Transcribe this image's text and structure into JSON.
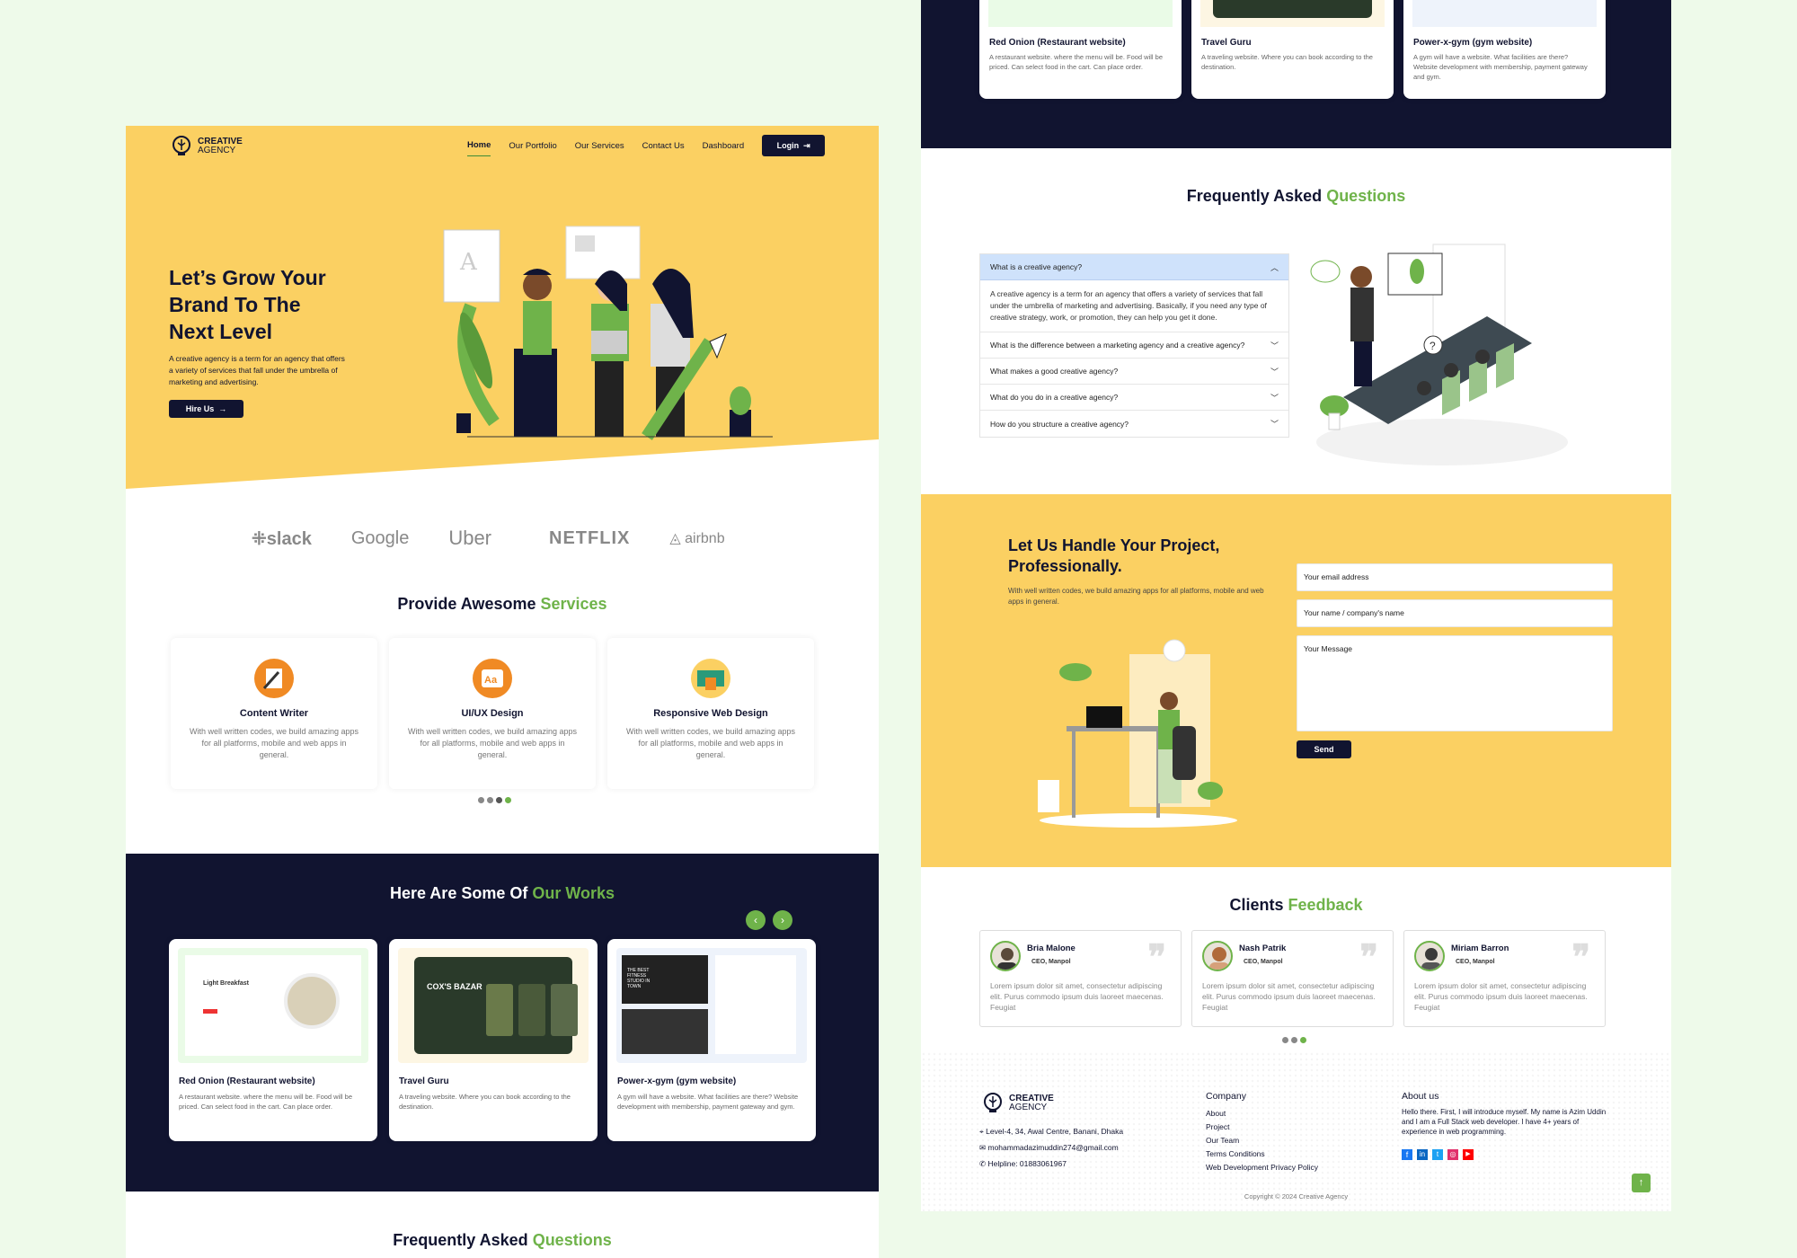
{
  "brand": {
    "name_line1": "CREATIVE",
    "name_line2": "AGENCY"
  },
  "nav": {
    "items": [
      "Home",
      "Our Portfolio",
      "Our Services",
      "Contact Us",
      "Dashboard"
    ],
    "login": "Login"
  },
  "hero": {
    "title_lines": [
      "Let’s Grow Your",
      "Brand To The",
      "Next Level"
    ],
    "text": "A creative agency is a term for an agency that offers a variety of services that fall under the umbrella of marketing and advertising.",
    "button": "Hire Us"
  },
  "partners": [
    "slack",
    "Google",
    "Uber",
    "NETFLIX",
    "airbnb"
  ],
  "services": {
    "title": "Provide Awesome",
    "title_accent": "Services",
    "items": [
      {
        "title": "Content Writer",
        "desc": "With well written codes, we build amazing apps for all platforms, mobile and web apps in general."
      },
      {
        "title": "UI/UX Design",
        "desc": "With well written codes, we build amazing apps for all platforms, mobile and web apps in general."
      },
      {
        "title": "Responsive Web Design",
        "desc": "With well written codes, we build amazing apps for all platforms, mobile and web apps in general."
      }
    ]
  },
  "works": {
    "title": "Here Are Some Of",
    "title_accent": "Our Works",
    "items": [
      {
        "title": "Red Onion (Restaurant website)",
        "desc": "A restaurant website. where the menu will be. Food will be priced. Can select food in the cart. Can place order.",
        "shot_label": "Light Breakfast"
      },
      {
        "title": "Travel Guru",
        "desc": "A traveling website. Where you can book according to the destination.",
        "shot_label": "COX'S BAZAR"
      },
      {
        "title": "Power-x-gym (gym website)",
        "desc": "A gym will have a website. What facilities are there? Website development with membership, payment gateway and gym.",
        "shot_label": "THE BEST FITNESS STUDIO IN TOWN"
      }
    ]
  },
  "faq": {
    "title": "Frequently Asked",
    "title_accent": "Questions",
    "items": [
      {
        "q": "What is a creative agency?",
        "a": "A creative agency is a term for an agency that offers a variety of services that fall under the umbrella of marketing and advertising. Basically, if you need any type of creative strategy, work, or promotion, they can help you get it done."
      },
      {
        "q": "What is the difference between a marketing agency and a creative agency?"
      },
      {
        "q": "What makes a good creative agency?"
      },
      {
        "q": "What do you do in a creative agency?"
      },
      {
        "q": "How do you structure a creative agency?"
      }
    ]
  },
  "contact": {
    "title_lines": [
      "Let Us Handle Your Project,",
      "Professionally."
    ],
    "text": "With well written codes, we build amazing apps for all platforms, mobile and web apps in general.",
    "email_placeholder": "Your email address",
    "name_placeholder": "Your name / company's name",
    "message_placeholder": "Your Message",
    "send": "Send"
  },
  "feedback": {
    "title": "Clients",
    "title_accent": "Feedback",
    "items": [
      {
        "name": "Bria Malone",
        "role": "CEO, Manpol",
        "text": "Lorem ipsum dolor sit amet, consectetur adipiscing elit. Purus commodo ipsum duis laoreet maecenas. Feugiat"
      },
      {
        "name": "Nash Patrik",
        "role": "CEO, Manpol",
        "text": "Lorem ipsum dolor sit amet, consectetur adipiscing elit. Purus commodo ipsum duis laoreet maecenas. Feugiat"
      },
      {
        "name": "Miriam Barron",
        "role": "CEO, Manpol",
        "text": "Lorem ipsum dolor sit amet, consectetur adipiscing elit. Purus commodo ipsum duis laoreet maecenas. Feugiat"
      }
    ]
  },
  "footer": {
    "address": "Level-4, 34, Awal Centre, Banani, Dhaka",
    "email": "mohammadazimuddin274@gmail.com",
    "helpline": "Helpline: 01883061967",
    "company_title": "Company",
    "company_links": [
      "About",
      "Project",
      "Our Team",
      "Terms Conditions",
      "Web Development Privacy Policy"
    ],
    "about_title": "About us",
    "about_text": "Hello there. First, I will introduce myself. My name is Azim Uddin and I am a Full Stack web developer. I have 4+ years of experience in web programming.",
    "copyright": "Copyright © 2024 Creative Agency"
  },
  "colors": {
    "yellow": "#fbd062",
    "navy": "#111430",
    "green": "#6fb34a",
    "page_bg": "#eefaea"
  }
}
